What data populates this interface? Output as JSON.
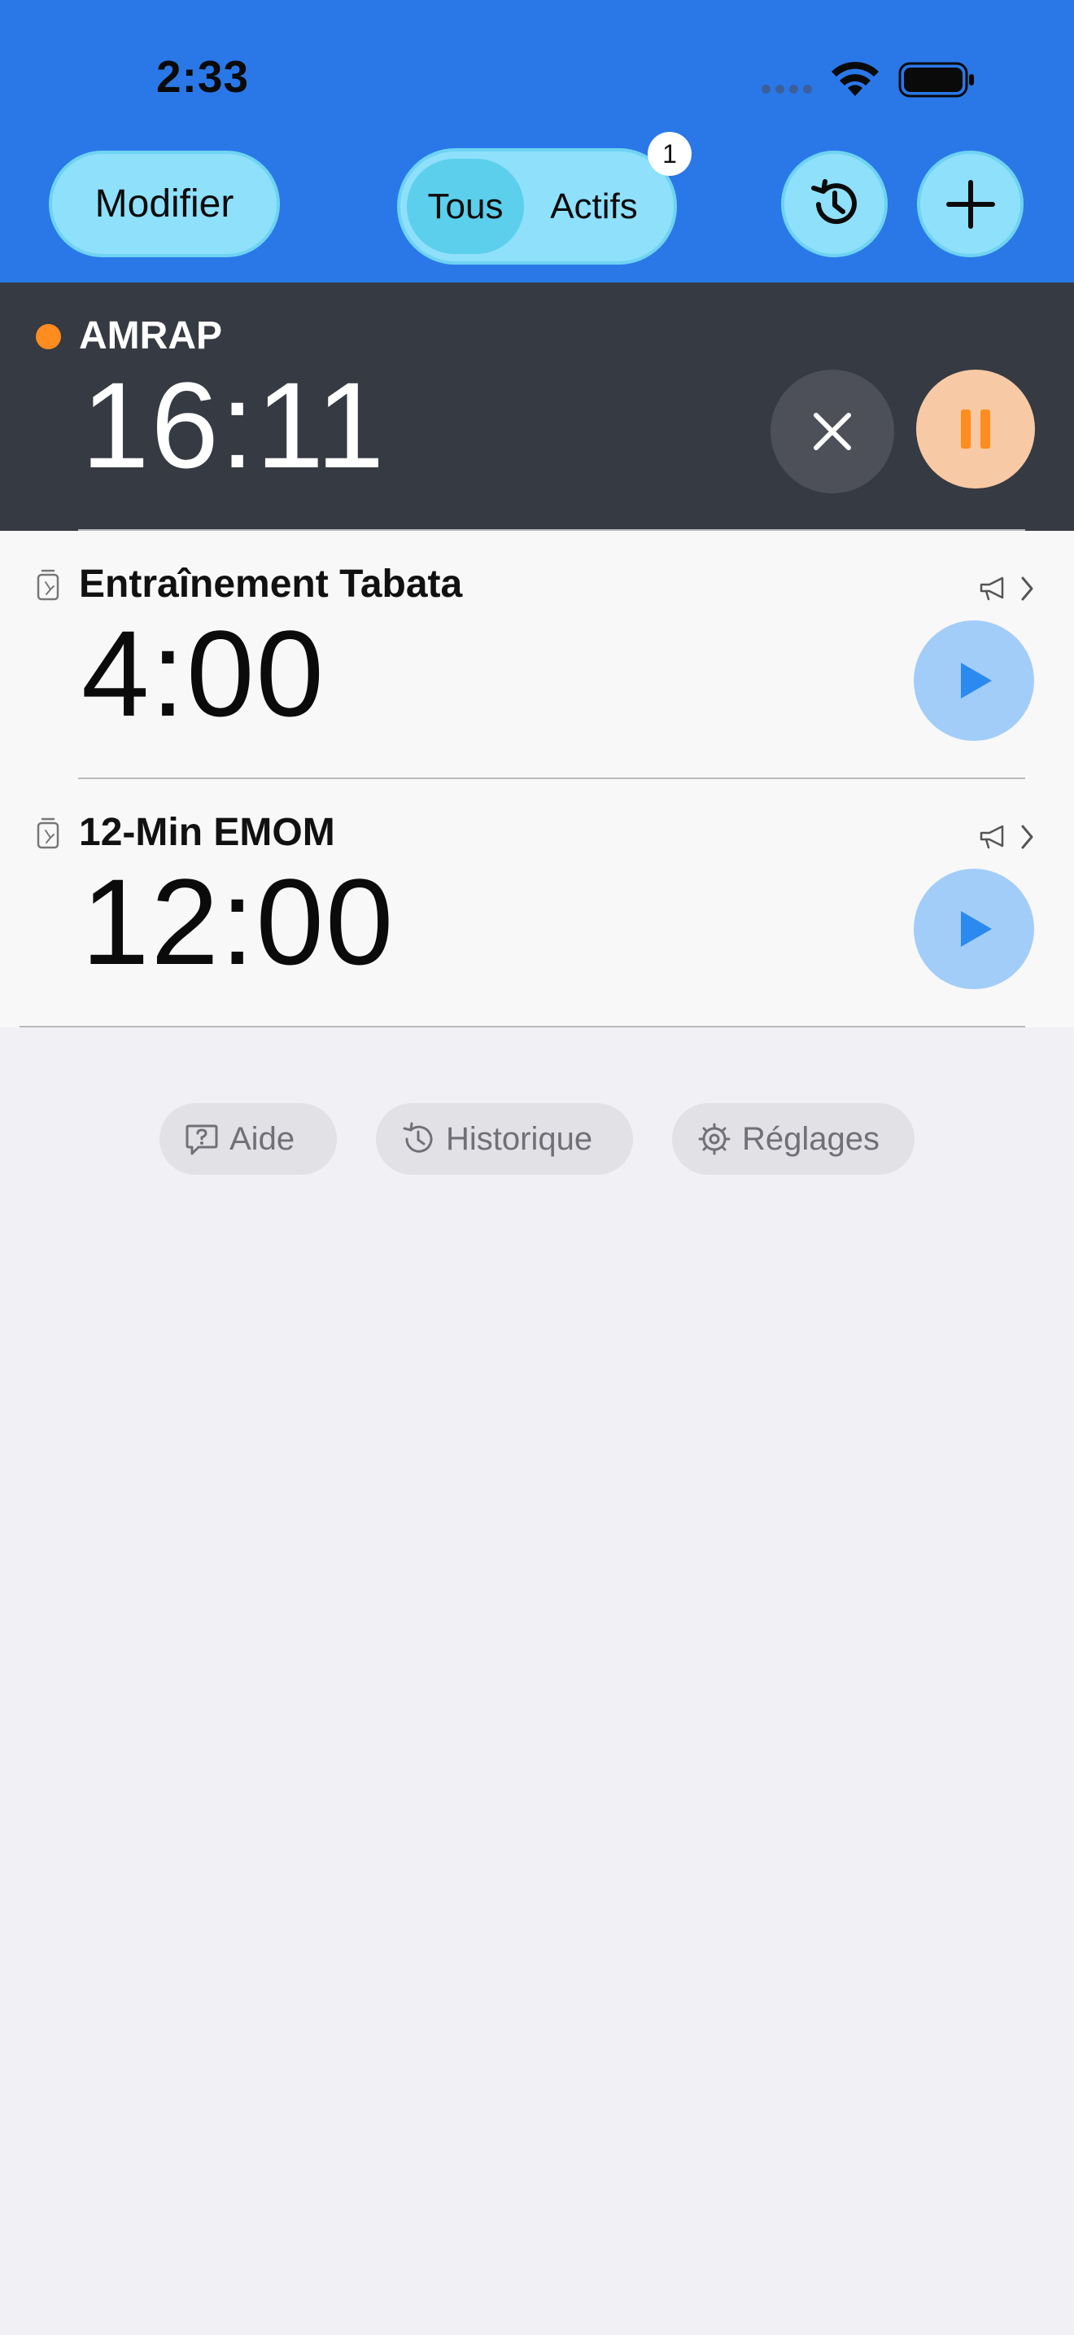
{
  "status_bar": {
    "time": "2:33"
  },
  "toolbar": {
    "edit_label": "Modifier",
    "segment_all": "Tous",
    "segment_active": "Actifs",
    "active_badge": "1"
  },
  "timers": [
    {
      "title": "AMRAP",
      "time": "16:11",
      "state": "running",
      "dot_color": "#ff8c1f"
    },
    {
      "title": "Entraînement Tabata",
      "time": "4:00",
      "state": "stopped"
    },
    {
      "title": "12-Min EMOM",
      "time": "12:00",
      "state": "stopped"
    }
  ],
  "footer": {
    "help_label": "Aide",
    "history_label": "Historique",
    "settings_label": "Réglages"
  },
  "colors": {
    "header": "#2a78e8",
    "accent_pill": "#8fe0fb",
    "running_row": "#363a42",
    "pause": "#ff8c1f",
    "play": "#2a8af0"
  }
}
